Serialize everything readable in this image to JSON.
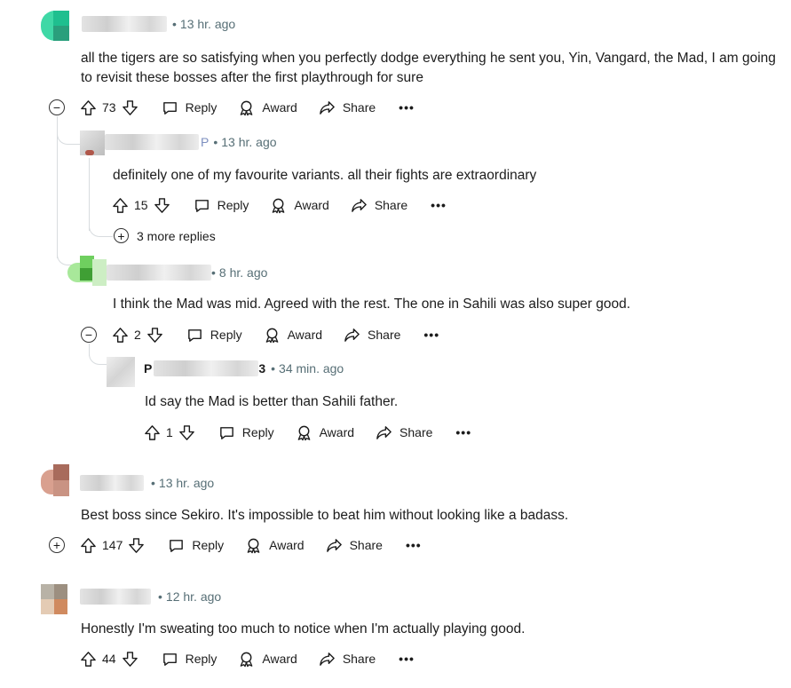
{
  "comments": [
    {
      "id": "c1",
      "time": "13 hr. ago",
      "text": "all the tigers are so satisfying when you perfectly dodge everything he sent you, Yin, Vangard, the Mad, I am going to revisit these bosses after the first playthrough for sure",
      "votes": "73"
    },
    {
      "id": "c1r1",
      "name_fragment": "P",
      "time": "13 hr. ago",
      "text": "definitely one of my favourite variants. all their fights are extraordinary",
      "votes": "15",
      "more_replies": "3 more replies"
    },
    {
      "id": "c1r2",
      "time": "8 hr. ago",
      "text": "I think the Mad was mid. Agreed with the rest. The one in Sahili was also super good.",
      "votes": "2"
    },
    {
      "id": "c1r2r1",
      "name_fragment_start": "P",
      "name_fragment_end": "3",
      "time": "34 min. ago",
      "text": "Id say the Mad is better than Sahili father.",
      "votes": "1"
    },
    {
      "id": "c2",
      "time": "13 hr. ago",
      "text": "Best boss since Sekiro. It's impossible to beat him without looking like a badass.",
      "votes": "147"
    },
    {
      "id": "c3",
      "time": "12 hr. ago",
      "text": "Honestly I'm sweating too much to notice when I'm actually playing good.",
      "votes": "44"
    }
  ],
  "labels": {
    "reply": "Reply",
    "award": "Award",
    "share": "Share",
    "more": "•••",
    "dot": "•"
  },
  "colors": {
    "meta": "#576f76",
    "thread_line": "#d8dcdf"
  }
}
